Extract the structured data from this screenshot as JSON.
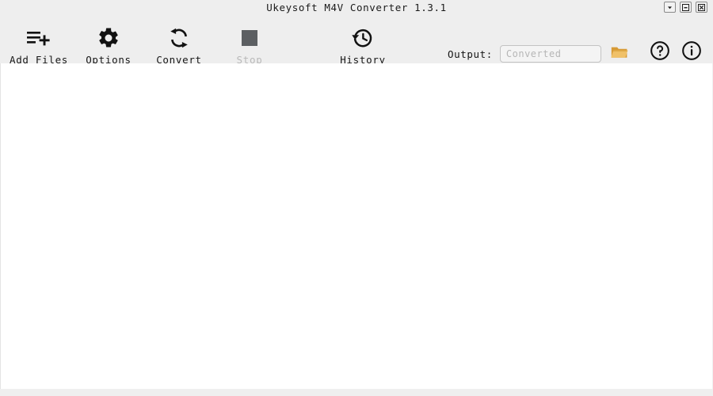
{
  "window": {
    "title": "Ukeysoft M4V Converter 1.3.1",
    "controls": [
      {
        "name": "menu-dropdown",
        "icon": "chevron-down-icon",
        "label": "Menu"
      },
      {
        "name": "minimize",
        "icon": "minimize-icon",
        "label": "Minimize"
      },
      {
        "name": "close",
        "icon": "close-icon",
        "label": "Close"
      }
    ]
  },
  "toolbar": {
    "items": [
      {
        "id": "add-files",
        "label": "Add Files",
        "icon": "playlist-add-icon",
        "disabled": false
      },
      {
        "id": "options",
        "label": "Options",
        "icon": "gear-icon",
        "disabled": false
      },
      {
        "id": "convert",
        "label": "Convert",
        "icon": "refresh-sync-icon",
        "disabled": false
      },
      {
        "id": "stop",
        "label": "Stop",
        "icon": "stop-square-icon",
        "disabled": true
      },
      {
        "id": "history",
        "label": "History",
        "icon": "history-clock-icon",
        "disabled": false
      }
    ],
    "output": {
      "label": "Output:",
      "value": "",
      "placeholder": "Converted",
      "browse_icon": "folder-open-icon"
    },
    "help": {
      "icon": "help-circle-icon",
      "label": "Help"
    },
    "info": {
      "icon": "info-circle-icon",
      "label": "About"
    }
  },
  "content": {
    "empty_text": ""
  },
  "colors": {
    "header_bg": "#eeeeee",
    "content_bg": "#ffffff",
    "text": "#161616",
    "disabled_text": "#b9b9b9",
    "folder_accent": "#e8a33d",
    "input_border": "#c3c3c3",
    "placeholder": "#b6b6b6"
  }
}
